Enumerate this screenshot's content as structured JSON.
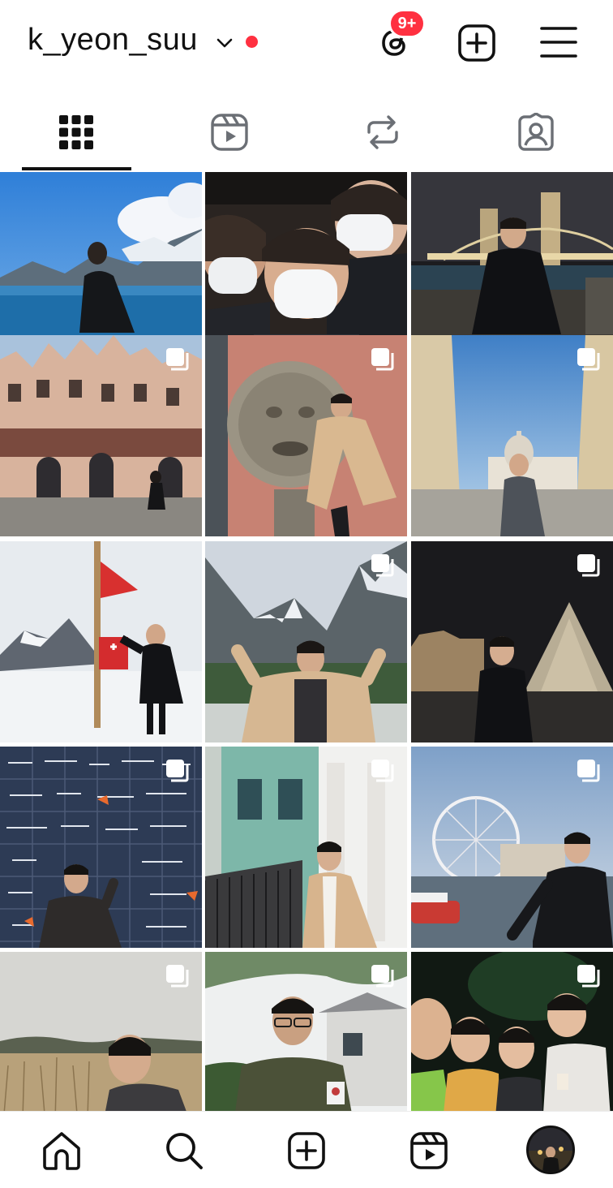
{
  "header": {
    "username": "k_yeon_suu",
    "notification_badge": "9+",
    "accent_color": "#ff3040"
  },
  "tabs": [
    {
      "name": "posts-grid",
      "icon": "grid-icon",
      "active": true
    },
    {
      "name": "reels",
      "icon": "reels-icon",
      "active": false
    },
    {
      "name": "reposts",
      "icon": "repost-icon",
      "active": false
    },
    {
      "name": "tagged",
      "icon": "tagged-person-icon",
      "active": false
    }
  ],
  "posts": [
    {
      "scene": "lake-mountains",
      "multi": false
    },
    {
      "scene": "selfie-masks",
      "multi": false
    },
    {
      "scene": "tower-bridge-night",
      "multi": false
    },
    {
      "scene": "half-timbered-hall",
      "multi": true
    },
    {
      "scene": "mouth-of-truth",
      "multi": true
    },
    {
      "scene": "st-peters-square",
      "multi": true
    },
    {
      "scene": "swiss-flag-snow",
      "multi": false
    },
    {
      "scene": "alpine-valley",
      "multi": true
    },
    {
      "scene": "louvre-pyramid-night",
      "multi": true
    },
    {
      "scene": "wall-of-love",
      "multi": true
    },
    {
      "scene": "townhouses",
      "multi": true
    },
    {
      "scene": "london-eye",
      "multi": true
    },
    {
      "scene": "reed-field",
      "multi": true
    },
    {
      "scene": "military-cafe",
      "multi": true
    },
    {
      "scene": "night-group",
      "multi": true
    }
  ],
  "bottom_nav": [
    {
      "name": "home",
      "icon": "home-icon"
    },
    {
      "name": "search",
      "icon": "search-icon"
    },
    {
      "name": "create",
      "icon": "add-post-icon"
    },
    {
      "name": "reels",
      "icon": "reels-icon"
    },
    {
      "name": "profile",
      "icon": "profile-avatar"
    }
  ]
}
